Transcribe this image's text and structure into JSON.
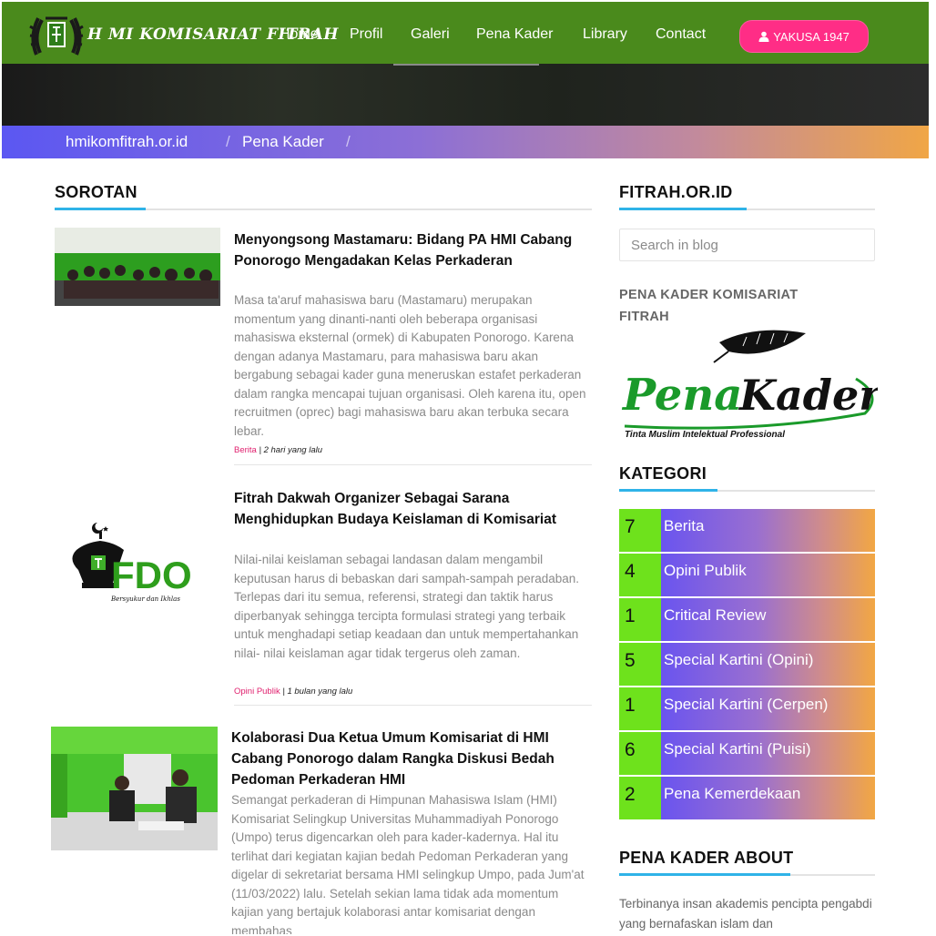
{
  "header": {
    "brand": "H MI KOMISARIAT FITRAH",
    "nav": [
      {
        "label": "Home"
      },
      {
        "label": "Profil"
      },
      {
        "label": "Galeri"
      },
      {
        "label": "Pena Kader"
      },
      {
        "label": "Library"
      },
      {
        "label": "Contact"
      }
    ],
    "cta_label": "YAKUSA 1947",
    "colors": {
      "nav_bg": "#4a8a1c",
      "cta": "#ff2d86"
    }
  },
  "breadcrumb": [
    "hmikomfitrah.or.id",
    "Pena Kader"
  ],
  "main": {
    "section_title": "SOROTAN",
    "articles": [
      {
        "title": "Menyongsong Mastamaru: Bidang PA HMI Cabang Ponorogo Mengadakan Kelas Perkaderan",
        "excerpt": "Masa ta'aruf mahasiswa baru (Mastamaru) merupakan momentum yang dinanti-nanti oleh beberapa organisasi mahasiswa eksternal (ormek) di Kabupaten Ponorogo. Karena dengan adanya Mastamaru, para mahasiswa baru akan bergabung sebagai kader guna meneruskan estafet perkaderan dalam rangka mencapai tujuan organisasi. Oleh karena itu, open recruitmen (oprec) bagi mahasiswa baru akan terbuka secara lebar.",
        "category": "Berita",
        "date": "2 hari yang lalu"
      },
      {
        "title": "Fitrah Dakwah Organizer Sebagai Sarana Menghidupkan Budaya Keislaman di Komisariat",
        "excerpt": "Nilai-nilai keislaman sebagai landasan dalam mengambil keputusan harus di bebaskan dari sampah-sampah peradaban. Terlepas dari itu semua, referensi, strategi dan taktik harus diperbanyak sehingga tercipta formulasi strategi yang terbaik untuk menghadapi setiap keadaan dan untuk mempertahankan nilai- nilai keislaman agar tidak tergerus oleh zaman.",
        "category": "Opini Publik",
        "date": "1 bulan yang lalu",
        "logo_text": "FDO",
        "logo_tagline": "Bersyukur dan Ikhlas"
      },
      {
        "title": "Kolaborasi Dua Ketua Umum Komisariat di HMI Cabang Ponorogo dalam Rangka Diskusi Bedah Pedoman Perkaderan HMI",
        "excerpt": "Semangat perkaderan di Himpunan Mahasiswa Islam (HMI) Komisariat Selingkup Universitas Muhammadiyah Ponorogo (Umpo) terus digencarkan oleh para kader-kadernya. Hal itu terlihat dari kegiatan kajian bedah Pedoman Perkaderan yang digelar di sekretariat bersama HMI selingkup Umpo, pada Jum'at (11/03/2022) lalu. Setelah sekian lama tidak ada momentum kajian yang bertajuk kolaborasi antar komisariat dengan membahas"
      }
    ]
  },
  "sidebar": {
    "site_title": "FITRAH.OR.ID",
    "search_placeholder": "Search in blog",
    "pena_title": "PENA KADER KOMISARIAT FITRAH",
    "pena_logo": {
      "word1": "Pena",
      "word2": "Kader",
      "tagline": "Tinta Muslim Intelektual Professional"
    },
    "kategori_title": "KATEGORI",
    "categories": [
      {
        "count": "7",
        "label": "Berita"
      },
      {
        "count": "4",
        "label": "Opini Publik"
      },
      {
        "count": "1",
        "label": "Critical Review"
      },
      {
        "count": "5",
        "label": "Special Kartini (Opini)"
      },
      {
        "count": "1",
        "label": "Special Kartini (Cerpen)"
      },
      {
        "count": "6",
        "label": "Special Kartini (Puisi)"
      },
      {
        "count": "2",
        "label": "Pena Kemerdekaan"
      }
    ],
    "about_title": "PENA KADER ABOUT",
    "about_text": "Terbinanya insan akademis pencipta pengabdi yang bernafaskan islam dan"
  }
}
